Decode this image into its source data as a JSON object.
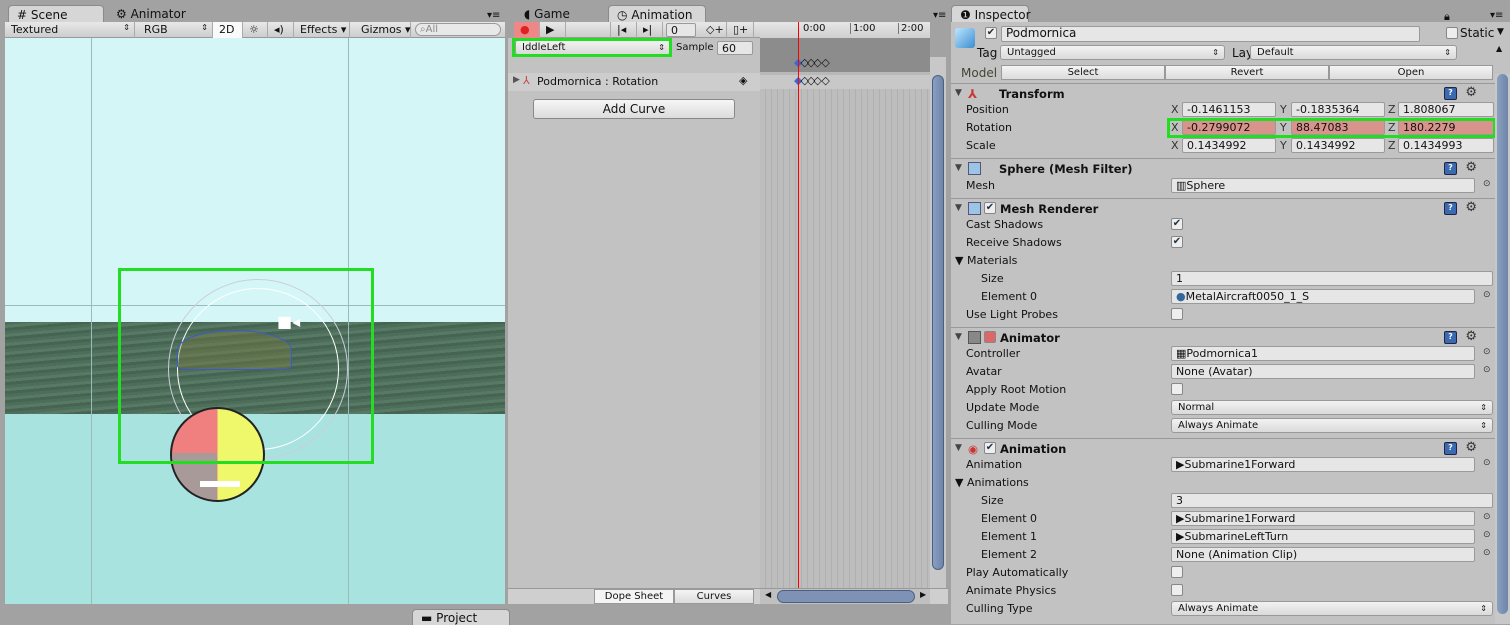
{
  "scene": {
    "tabs": [
      "Scene",
      "Animator"
    ],
    "shading": "Textured",
    "channel": "RGB",
    "btn_2d": "2D",
    "effects": "Effects",
    "gizmos": "Gizmos",
    "search_placeholder": "All"
  },
  "animation": {
    "tabs": [
      "Game",
      "Animation"
    ],
    "frame": "0",
    "clip": "IddleLeft",
    "sample_label": "Sample",
    "sample": "60",
    "ticks": [
      "0:00",
      "1:00",
      "2:00"
    ],
    "property": "Podmornica : Rotation",
    "add_curve": "Add Curve",
    "bottom_tabs": [
      "Dope Sheet",
      "Curves"
    ]
  },
  "bottom": {
    "project_tab": "Project"
  },
  "inspector": {
    "tab": "Inspector",
    "name": "Podmornica",
    "static_label": "Static",
    "tag_label": "Tag",
    "tag": "Untagged",
    "layer_label": "Layer",
    "layer": "Default",
    "model_label": "Model",
    "model_buttons": [
      "Select",
      "Revert",
      "Open"
    ],
    "transform": {
      "title": "Transform",
      "rows": [
        {
          "label": "Position",
          "x": "-0.1461153",
          "y": "-0.1835364",
          "z": "1.808067"
        },
        {
          "label": "Rotation",
          "x": "-0.2799072",
          "y": "88.47083",
          "z": "180.2279"
        },
        {
          "label": "Scale",
          "x": "0.1434992",
          "y": "0.1434992",
          "z": "0.1434993"
        }
      ],
      "axes": [
        "X",
        "Y",
        "Z"
      ]
    },
    "mesh_filter": {
      "title": "Sphere (Mesh Filter)",
      "mesh_label": "Mesh",
      "mesh": "Sphere"
    },
    "mesh_renderer": {
      "title": "Mesh Renderer",
      "cast": "Cast Shadows",
      "receive": "Receive Shadows",
      "materials": "Materials",
      "size_label": "Size",
      "size": "1",
      "el0_label": "Element 0",
      "el0": "MetalAircraft0050_1_S",
      "probes": "Use Light Probes"
    },
    "animator": {
      "title": "Animator",
      "controller_label": "Controller",
      "controller": "Podmornica1",
      "avatar_label": "Avatar",
      "avatar": "None (Avatar)",
      "root_motion": "Apply Root Motion",
      "update_label": "Update Mode",
      "update": "Normal",
      "culling_label": "Culling Mode",
      "culling": "Always Animate"
    },
    "animation_comp": {
      "title": "Animation",
      "anim_label": "Animation",
      "anim": "Submarine1Forward",
      "anims_label": "Animations",
      "size_label": "Size",
      "size": "3",
      "elements": [
        {
          "label": "Element 0",
          "value": "Submarine1Forward"
        },
        {
          "label": "Element 1",
          "value": "SubmarineLeftTurn"
        },
        {
          "label": "Element 2",
          "value": "None (Animation Clip)"
        }
      ],
      "play_auto": "Play Automatically",
      "physics": "Animate Physics",
      "culling_label": "Culling Type",
      "culling": "Always Animate"
    }
  },
  "colors": {
    "highlight": "#00e000",
    "record": "#e05050",
    "animated_field": "#d8938c",
    "playhead": "#ff0000"
  }
}
